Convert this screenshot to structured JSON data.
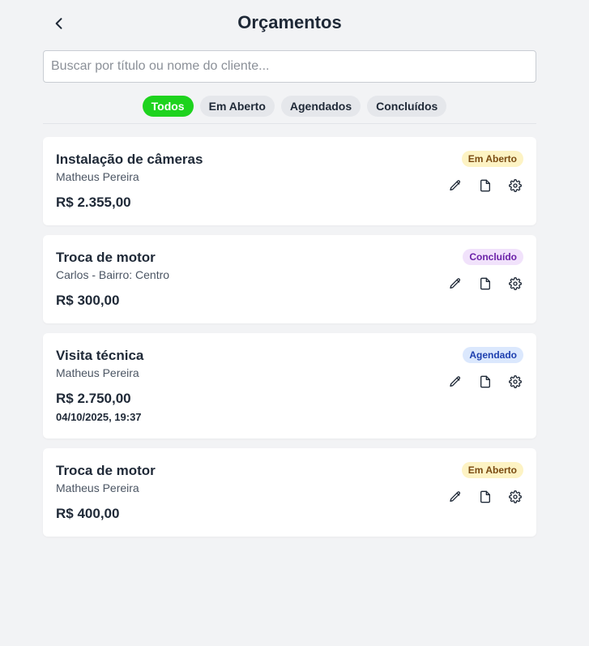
{
  "header": {
    "title": "Orçamentos"
  },
  "search": {
    "placeholder": "Buscar por título ou nome do cliente...",
    "value": ""
  },
  "filters": [
    {
      "label": "Todos",
      "active": true
    },
    {
      "label": "Em Aberto",
      "active": false
    },
    {
      "label": "Agendados",
      "active": false
    },
    {
      "label": "Concluídos",
      "active": false
    }
  ],
  "quotes": [
    {
      "title": "Instalação de câmeras",
      "client": "Matheus Pereira",
      "value": "R$ 2.355,00",
      "date": "",
      "status": "Em Aberto",
      "status_type": "open"
    },
    {
      "title": "Troca de motor",
      "client": "Carlos - Bairro: Centro",
      "value": "R$ 300,00",
      "date": "",
      "status": "Concluído",
      "status_type": "done"
    },
    {
      "title": "Visita técnica",
      "client": "Matheus Pereira",
      "value": "R$ 2.750,00",
      "date": "04/10/2025, 19:37",
      "status": "Agendado",
      "status_type": "scheduled"
    },
    {
      "title": "Troca de motor",
      "client": "Matheus Pereira",
      "value": "R$ 400,00",
      "date": "",
      "status": "Em Aberto",
      "status_type": "open"
    }
  ],
  "colors": {
    "accent": "#1ed31e",
    "background": "#f2f3f5",
    "status_open_bg": "#fdf3c4",
    "status_done_bg": "#f1e2fb",
    "status_scheduled_bg": "#dbe8fd"
  },
  "icons": {
    "back": "chevron-left-icon",
    "edit": "pencil-icon",
    "document": "document-icon",
    "settings": "gear-icon"
  }
}
